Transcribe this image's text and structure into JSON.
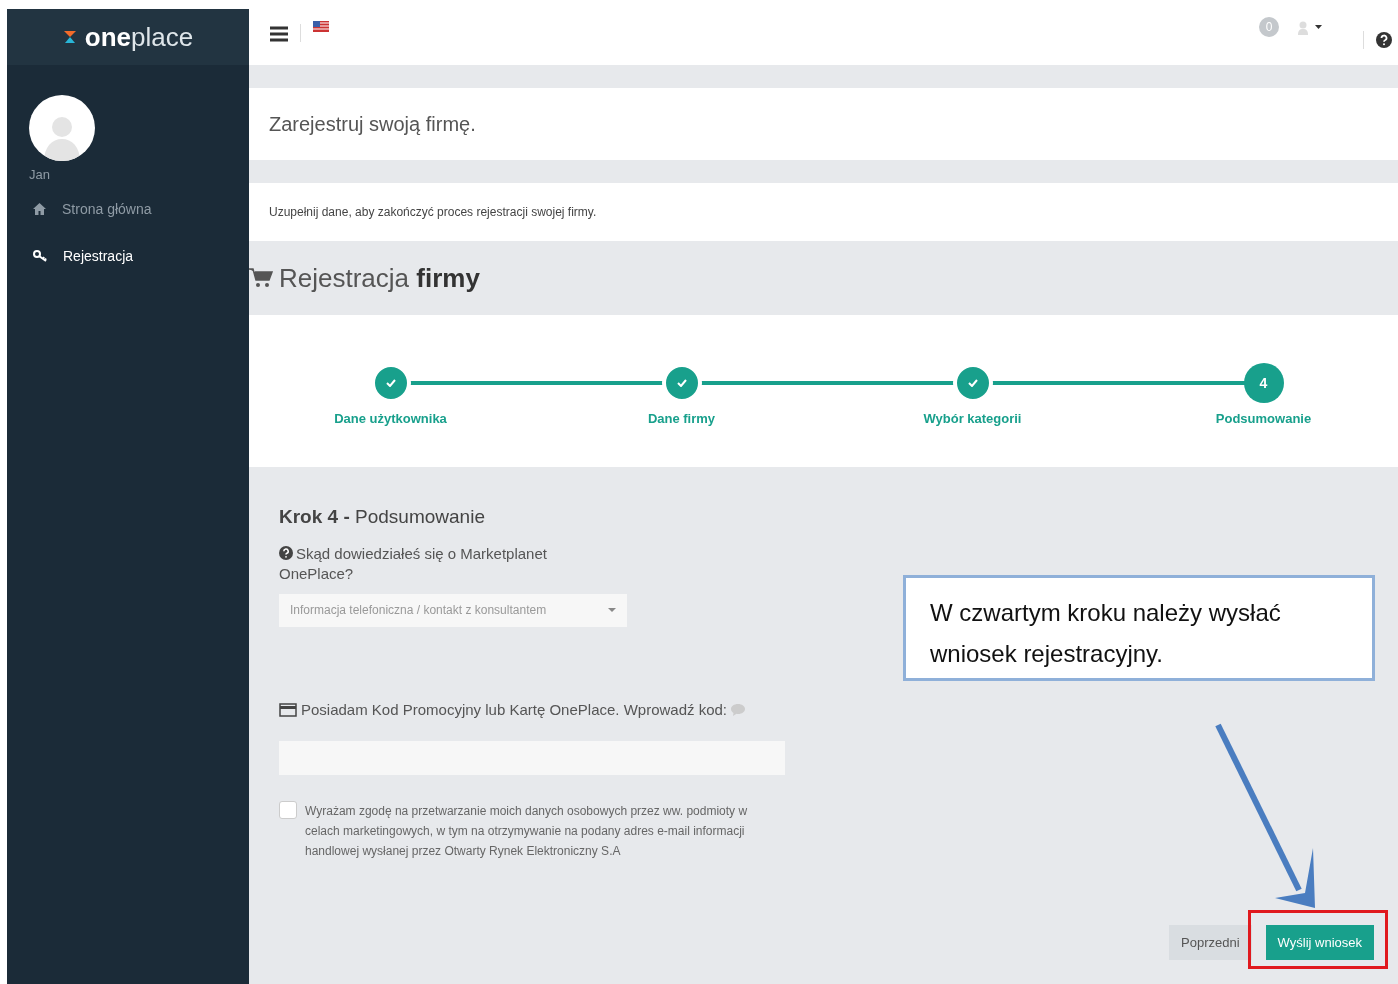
{
  "logo": {
    "bold": "one",
    "light": "place"
  },
  "user": {
    "name": "Jan"
  },
  "sidebar": {
    "items": [
      {
        "label": "Strona główna",
        "selected": false
      },
      {
        "label": "Rejestracja",
        "selected": true
      }
    ]
  },
  "topbar": {
    "notifications": "0"
  },
  "page_title": "Zarejestruj swoją firmę.",
  "intro": "Uzupełnij dane, aby zakończyć proces rejestracji swojej firmy.",
  "section": {
    "title_light": "Rejestracja",
    "title_bold": "firmy"
  },
  "steps": [
    {
      "label": "Dane użytkownika",
      "completed": true
    },
    {
      "label": "Dane firmy",
      "completed": true
    },
    {
      "label": "Wybór kategorii",
      "completed": true
    },
    {
      "label": "Podsumowanie",
      "number": "4",
      "completed": false
    }
  ],
  "form": {
    "step_bold": "Krok 4 -",
    "step_title": "Podsumowanie",
    "source_label": "Skąd dowiedziałeś się o Marketplanet OnePlace?",
    "source_value": "Informacja telefoniczna / kontakt z konsultantem",
    "promo_label": "Posiadam Kod Promocyjny lub Kartę OnePlace. Wprowadź kod:",
    "consent": {
      "label": "Wyrażam zgodę na przetwarzanie moich danych osobowych przez ww. podmioty w celach marketingowych, w tym na otrzymywanie na podany adres e-mail informacji handlowej wysłanej przez Otwarty Rynek Elektroniczny S.A",
      "checked": false
    },
    "buttons": [
      {
        "label": "Poprzedni",
        "kind": "secondary"
      },
      {
        "label": "Wyślij wniosek",
        "kind": "primary"
      }
    ]
  },
  "annotation": {
    "text": "W czwartym kroku należy wysłać wniosek rejestracyjny."
  }
}
